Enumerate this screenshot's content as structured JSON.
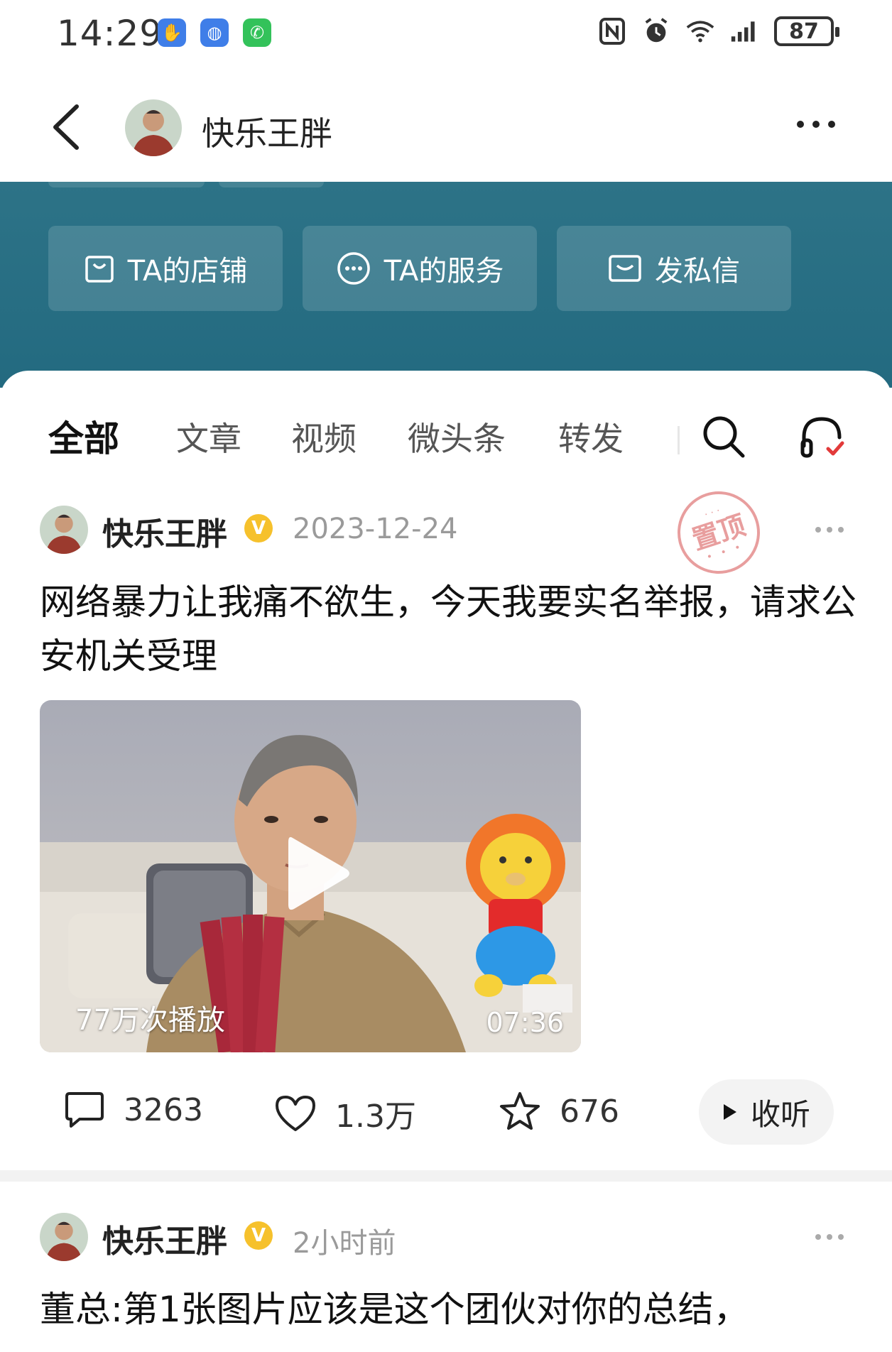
{
  "status_bar": {
    "time": "14:29",
    "battery": "87",
    "left_icons": [
      "gesture-app-icon",
      "browser-app-icon",
      "phone-app-icon"
    ],
    "right_icons": [
      "nfc-icon",
      "alarm-icon",
      "wifi-icon",
      "signal-icon",
      "battery-icon"
    ]
  },
  "header": {
    "name": "快乐王胖"
  },
  "actions": {
    "shop": "TA的店铺",
    "service": "TA的服务",
    "message": "发私信"
  },
  "tabs": [
    "全部",
    "文章",
    "视频",
    "微头条",
    "转发"
  ],
  "posts": [
    {
      "author": "快乐王胖",
      "verified": "V",
      "date": "2023-12-24",
      "pinned_label": "置顶",
      "title": "网络暴力让我痛不欲生，今天我要实名举报，请求公安机关受理",
      "video_views": "77万次播放",
      "video_duration": "07:36",
      "comments": "3263",
      "likes": "1.3万",
      "favorites": "676",
      "listen_label": "收听"
    },
    {
      "author": "快乐王胖",
      "verified": "V",
      "date": "2小时前",
      "title": "董总:第1张图片应该是这个团伙对你的总结，"
    }
  ],
  "colors": {
    "banner": "#236a80",
    "verified": "#f6c12c",
    "stamp": "#e58e8e"
  }
}
